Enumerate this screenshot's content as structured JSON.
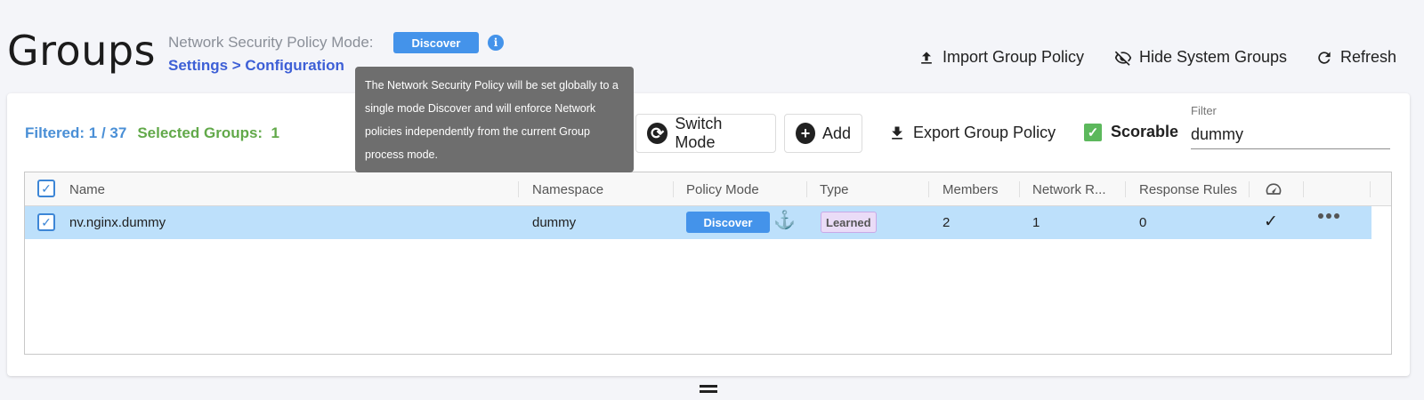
{
  "header": {
    "title": "Groups",
    "mode_label": "Network Security Policy Mode:",
    "mode_value": "Discover",
    "breadcrumb": "Settings > Configuration",
    "actions": {
      "import": "Import Group Policy",
      "hide_system": "Hide System Groups",
      "refresh": "Refresh"
    }
  },
  "tooltip": {
    "text": "The Network Security Policy will be set globally to a single mode Discover and will enforce Network policies independently from the current Group process mode."
  },
  "toolbar": {
    "filtered": "Filtered: 1 / 37",
    "selected_label": "Selected Groups:",
    "selected_count": "1",
    "switch_mode": "Switch Mode",
    "add": "Add",
    "export": "Export Group Policy",
    "scorable": "Scorable",
    "filter_label": "Filter",
    "filter_value": "dummy"
  },
  "table": {
    "columns": [
      "Name",
      "Namespace",
      "Policy Mode",
      "Type",
      "Members",
      "Network R...",
      "Response Rules"
    ],
    "rows": [
      {
        "name": "nv.nginx.dummy",
        "namespace": "dummy",
        "policy_mode": "Discover",
        "type": "Learned",
        "members": "2",
        "network_rules": "1",
        "response_rules": "0"
      }
    ]
  },
  "colors": {
    "accent": "#4493ea",
    "link": "#3d5fd6",
    "filtered_text": "#4a8fd6",
    "selected_text": "#62a94a",
    "row_selected": "#bde0fb",
    "learned_badge": "#eadcf7"
  }
}
